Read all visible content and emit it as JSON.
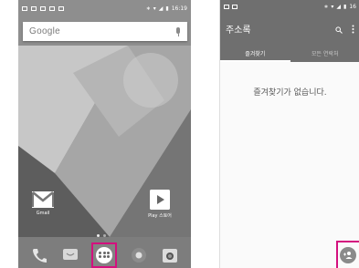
{
  "left_screen": {
    "status_time": "16:19",
    "search": {
      "logo": "Google"
    },
    "apps": {
      "gmail_label": "Gmail",
      "play_label": "Play 스토어"
    },
    "dock": [
      "phone-icon",
      "messages-icon",
      "app-drawer-icon",
      "browser-icon",
      "camera-icon"
    ]
  },
  "right_screen": {
    "status_time": "16",
    "title": "주소록",
    "tabs": [
      {
        "label": "즐겨찾기",
        "active": true
      },
      {
        "label": "모든 연락처",
        "active": false
      }
    ],
    "empty_message": "즐겨찾기가 없습니다."
  },
  "colors": {
    "highlight": "#d4107e",
    "appbar": "#6f6f6f",
    "fab": "#8a8a8a"
  }
}
